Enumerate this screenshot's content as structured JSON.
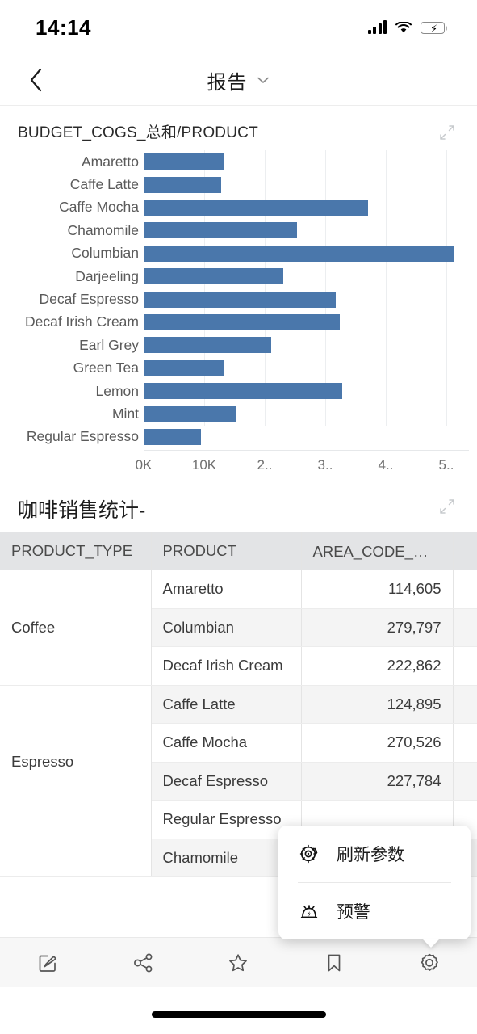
{
  "status_bar": {
    "time": "14:14",
    "signal_icon": "signal-bars-icon",
    "wifi_icon": "wifi-icon",
    "battery_icon": "battery-charging-icon"
  },
  "nav": {
    "back_icon": "chevron-left-icon",
    "title": "报告",
    "dropdown_icon": "chevron-down-icon"
  },
  "chart_card": {
    "title": "BUDGET_COGS_总和/PRODUCT",
    "expand_icon": "expand-arrow-icon"
  },
  "chart_data": {
    "type": "bar",
    "orientation": "horizontal",
    "title": "BUDGET_COGS_总和/PRODUCT",
    "xlabel": "",
    "ylabel": "",
    "xlim": [
      0,
      52000
    ],
    "grid": true,
    "legend": false,
    "tick_labels": [
      "0K",
      "10K",
      "2..",
      "3..",
      "4..",
      "5.."
    ],
    "tick_values": [
      0,
      10000,
      20000,
      30000,
      40000,
      50000
    ],
    "categories": [
      "Amaretto",
      "Caffe Latte",
      "Caffe Mocha",
      "Chamomile",
      "Columbian",
      "Darjeeling",
      "Decaf Espresso",
      "Decaf Irish Cream",
      "Earl Grey",
      "Green Tea",
      "Lemon",
      "Mint",
      "Regular Espresso"
    ],
    "values": [
      13300,
      12800,
      37100,
      25300,
      51300,
      23000,
      31700,
      32400,
      21000,
      13200,
      32800,
      15200,
      9500
    ],
    "bar_color": "#4a77ab"
  },
  "table_card": {
    "title": "咖啡销售统计-",
    "expand_icon": "expand-arrow-icon",
    "columns": [
      "PRODUCT_TYPE",
      "PRODUCT",
      "AREA_CODE_总和",
      ""
    ],
    "groups": [
      {
        "type": "Coffee",
        "rows": [
          {
            "product": "Amaretto",
            "area_code_sum": "114,605",
            "extra": ""
          },
          {
            "product": "Columbian",
            "area_code_sum": "279,797",
            "extra": ""
          },
          {
            "product": "Decaf Irish Cream",
            "area_code_sum": "222,862",
            "extra": ""
          }
        ]
      },
      {
        "type": "Espresso",
        "rows": [
          {
            "product": "Caffe Latte",
            "area_code_sum": "124,895",
            "extra": ""
          },
          {
            "product": "Caffe Mocha",
            "area_code_sum": "270,526",
            "extra": ""
          },
          {
            "product": "Decaf Espresso",
            "area_code_sum": "227,784",
            "extra": ""
          },
          {
            "product": "Regular Espresso",
            "area_code_sum": "",
            "extra": ""
          }
        ]
      },
      {
        "type": "",
        "rows": [
          {
            "product": "Chamomile",
            "area_code_sum": "",
            "extra": ""
          }
        ]
      }
    ]
  },
  "popup_menu": {
    "items": [
      {
        "label": "刷新参数",
        "icon": "refresh-parameters-icon"
      },
      {
        "label": "预警",
        "icon": "alert-bell-icon"
      }
    ]
  },
  "toolbar": {
    "items": [
      {
        "name": "annotate",
        "icon": "edit-square-icon"
      },
      {
        "name": "share",
        "icon": "share-nodes-icon"
      },
      {
        "name": "favorite",
        "icon": "star-icon"
      },
      {
        "name": "bookmark",
        "icon": "bookmark-icon"
      },
      {
        "name": "settings",
        "icon": "gear-icon"
      }
    ]
  }
}
